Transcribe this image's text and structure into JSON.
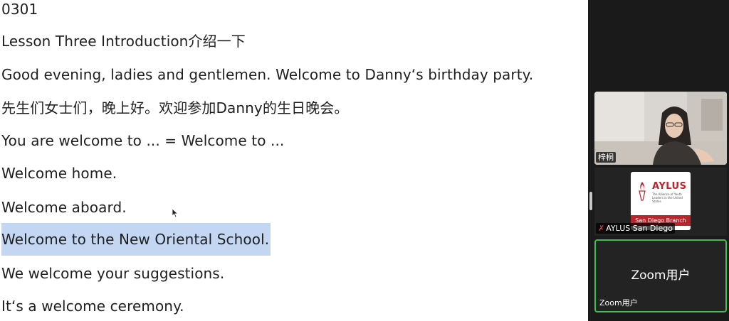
{
  "document": {
    "lines": [
      "0301",
      "Lesson Three Introduction介绍一下",
      "Good evening, ladies and gentlemen. Welcome to Danny‘s birthday party.",
      "先生们女士们，晚上好。欢迎参加Danny的生日晚会。",
      "You are welcome to ... = Welcome to ...",
      "Welcome home.",
      "Welcome aboard.",
      "Welcome to the New Oriental School.",
      "We welcome your suggestions.",
      "It‘s a welcome ceremony."
    ],
    "highlight_color": "#c3d7f3"
  },
  "participants": [
    {
      "name": "梓桐",
      "video": "camera-on"
    },
    {
      "name": "AYLUS San Diego",
      "muted": true,
      "logo": {
        "name": "AYLUS",
        "tagline": "The Alliance of Youth Leaders in the United States",
        "branch": "San Diego Branch"
      }
    },
    {
      "name": "Zoom用户",
      "display_name": "Zoom用户",
      "active_speaker": true,
      "active_color": "#3fbf4e"
    }
  ]
}
